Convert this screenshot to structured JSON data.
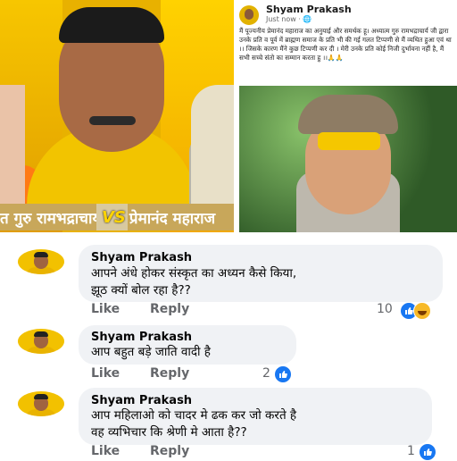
{
  "collage": {
    "caption_left": "त गुरु रामभद्राचार्य",
    "vs": "VS",
    "caption_right": "प्रेमानंद महाराज"
  },
  "post": {
    "author": "Shyam Prakash",
    "meta": "Just now · 🌐",
    "body": "मैं पूज्यनीय प्रेमानंद महाराज का अनुयाई और समर्थक हू। अध्यात्म गुरु रामभद्राचार्य जी द्वारा उनके प्रति व पूर्व में ब्राह्मण समाज के प्रति भी की गई गलत टिप्पणी से मैं व्यथित हुआ एवं था ।। जिसके कारण मैंने कुछ टिप्पणी कर दी । मेरी उनके प्रति कोई निजी दुर्भावना नहीं है, मैं सभी सच्चे संतो का सम्मान करता हु ।।🙏🙏"
  },
  "comments": [
    {
      "author": "Shyam Prakash",
      "text_line1": "आपने अंधे होकर संस्कृत का अध्यन कैसे किया,",
      "text_line2": "झूठ क्यों बोल रहा है??",
      "like_label": "Like",
      "reply_label": "Reply",
      "count": "10",
      "reactions": [
        "like-icon",
        "haha-icon"
      ]
    },
    {
      "author": "Shyam Prakash",
      "text_line1": "आप बहुत बड़े जाति वादी है",
      "text_line2": "",
      "like_label": "Like",
      "reply_label": "Reply",
      "count": "2",
      "reactions": [
        "like-icon"
      ]
    },
    {
      "author": "Shyam Prakash",
      "text_line1": "आप महिलाओ को चादर मे ढक कर जो करते है",
      "text_line2": "वह व्यभिचार कि श्रेणी मे आता है??",
      "like_label": "Like",
      "reply_label": "Reply",
      "count": "1",
      "reactions": [
        "like-icon"
      ]
    }
  ],
  "colors": {
    "accent": "#1877f2",
    "bubble": "#f0f2f5",
    "muted": "#65676b",
    "saffron": "#f2c100"
  }
}
